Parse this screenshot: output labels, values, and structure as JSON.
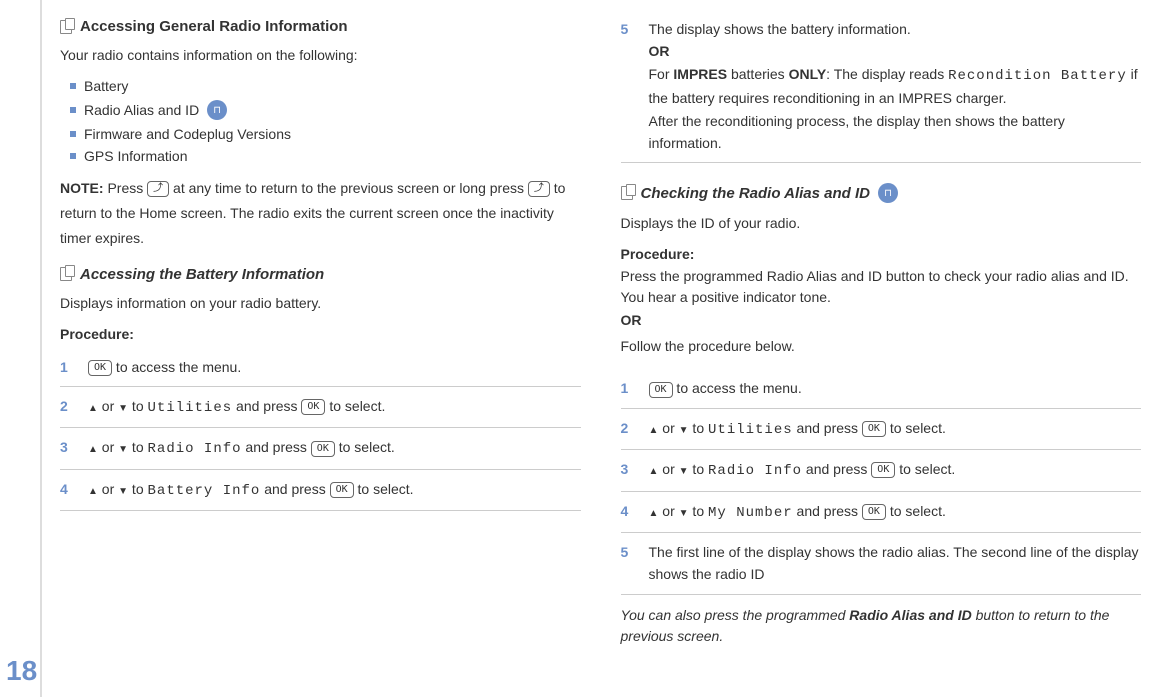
{
  "page_number": "18",
  "left": {
    "section1": {
      "title": "Accessing General Radio Information",
      "intro": "Your radio contains information on the following:",
      "bullets": [
        "Battery",
        "Radio Alias and ID",
        "Firmware and Codeplug Versions",
        "GPS Information"
      ],
      "note_label": "NOTE:",
      "note_text_1": "Press ",
      "note_text_2": " at any time to return to the previous screen or long press ",
      "note_text_3": " to return to the Home screen. The radio exits the current screen once the inactivity timer expires.",
      "key_back": "⤴"
    },
    "section2": {
      "title": "Accessing the Battery Information",
      "intro": "Displays information on your radio battery.",
      "procedure_label": "Procedure:",
      "steps": [
        {
          "n": "1",
          "pre": "",
          "key1": "OK",
          "mid": " to access the menu."
        },
        {
          "n": "2",
          "pre": "",
          "arrow": true,
          "mid1": " or ",
          "mid2": " to ",
          "mono": "Utilities",
          "mid3": " and press ",
          "key": "OK",
          "end": " to select."
        },
        {
          "n": "3",
          "pre": "",
          "arrow": true,
          "mid1": " or ",
          "mid2": " to ",
          "mono": "Radio Info",
          "mid3": " and press ",
          "key": "OK",
          "end": " to select."
        },
        {
          "n": "4",
          "pre": "",
          "arrow": true,
          "mid1": " or ",
          "mid2": " to ",
          "mono": "Battery Info",
          "mid3": " and press ",
          "key": "OK",
          "end": " to select."
        }
      ]
    }
  },
  "right": {
    "step5": {
      "n": "5",
      "line1": "The display shows the battery information.",
      "or": "OR",
      "line2a": "For ",
      "line2b": "IMPRES",
      "line2c": " batteries ",
      "line2d": "ONLY",
      "line2e": ": The display reads ",
      "mono": "Recondition Battery",
      "line2f": " if the battery requires reconditioning in an IMPRES charger.",
      "line3": "After the reconditioning process, the display then shows the battery information."
    },
    "section3": {
      "title": "Checking the Radio Alias and ID",
      "intro": "Displays the ID of your radio.",
      "procedure_label": "Procedure:",
      "proc_text1": "Press the programmed Radio Alias and ID button to check your radio alias and ID. You hear a positive indicator tone.",
      "or": "OR",
      "follow": "Follow the procedure below.",
      "steps": [
        {
          "n": "1",
          "key1": "OK",
          "mid": " to access the menu."
        },
        {
          "n": "2",
          "arrow": true,
          "mid1": " or ",
          "mid2": " to ",
          "mono": "Utilities",
          "mid3": " and press ",
          "key": "OK",
          "end": " to select."
        },
        {
          "n": "3",
          "arrow": true,
          "mid1": " or ",
          "mid2": " to ",
          "mono": "Radio Info",
          "mid3": " and press ",
          "key": "OK",
          "end": " to select."
        },
        {
          "n": "4",
          "arrow": true,
          "mid1": " or ",
          "mid2": " to ",
          "mono": "My Number",
          "mid3": " and press ",
          "key": "OK",
          "end": " to select."
        },
        {
          "n": "5",
          "text": "The first line of the display shows the radio alias. The second line of the display shows the radio ID"
        }
      ],
      "footnote_a": "You can also press the programmed ",
      "footnote_b": "Radio Alias and ID",
      "footnote_c": " button to return to the previous screen."
    }
  }
}
